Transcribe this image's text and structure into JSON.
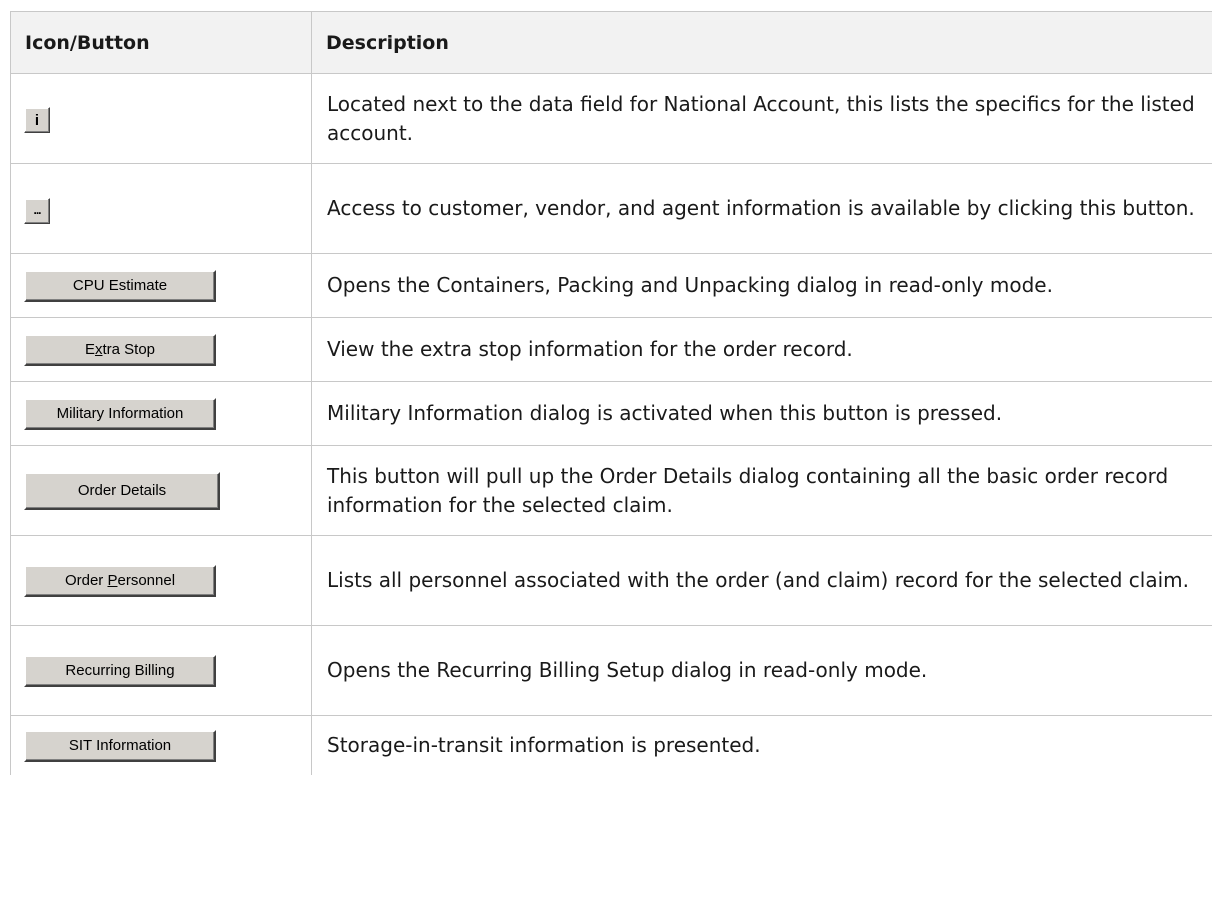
{
  "table": {
    "headers": {
      "icon": "Icon/Button",
      "description": "Description"
    },
    "rows": [
      {
        "icon": {
          "type": "small",
          "label": "i",
          "name": "info-icon"
        },
        "description": "Located next to the data field for National Account, this lists the specifics for the listed account."
      },
      {
        "icon": {
          "type": "small",
          "label": "...",
          "name": "ellipsis-icon"
        },
        "description": "Access to customer, vendor, and agent information is available by clicking this button."
      },
      {
        "icon": {
          "type": "button",
          "label": "CPU Estimate"
        },
        "description": "Opens the Containers, Packing and Unpacking dialog in read-only mode."
      },
      {
        "icon": {
          "type": "button",
          "label_pre": "E",
          "label_mnemonic": "x",
          "label_post": "tra Stop"
        },
        "description": "View the extra stop information for the order record."
      },
      {
        "icon": {
          "type": "button",
          "label": "Military Information"
        },
        "description": "Military Information dialog is activated when this button is pressed."
      },
      {
        "icon": {
          "type": "button",
          "label": "Order Details"
        },
        "description": "This button will pull up the Order Details dialog containing all the basic order record information for the selected claim."
      },
      {
        "icon": {
          "type": "button",
          "label_pre": "Order ",
          "label_mnemonic": "P",
          "label_post": "ersonnel"
        },
        "description": "Lists all personnel associated with the order (and claim) record for the selected claim."
      },
      {
        "icon": {
          "type": "button",
          "label": "Recurring Billing"
        },
        "description": "Opens the Recurring Billing Setup dialog in read-only mode."
      },
      {
        "icon": {
          "type": "button",
          "label": "SIT Information"
        },
        "description": "Storage-in-transit information is presented."
      }
    ]
  }
}
